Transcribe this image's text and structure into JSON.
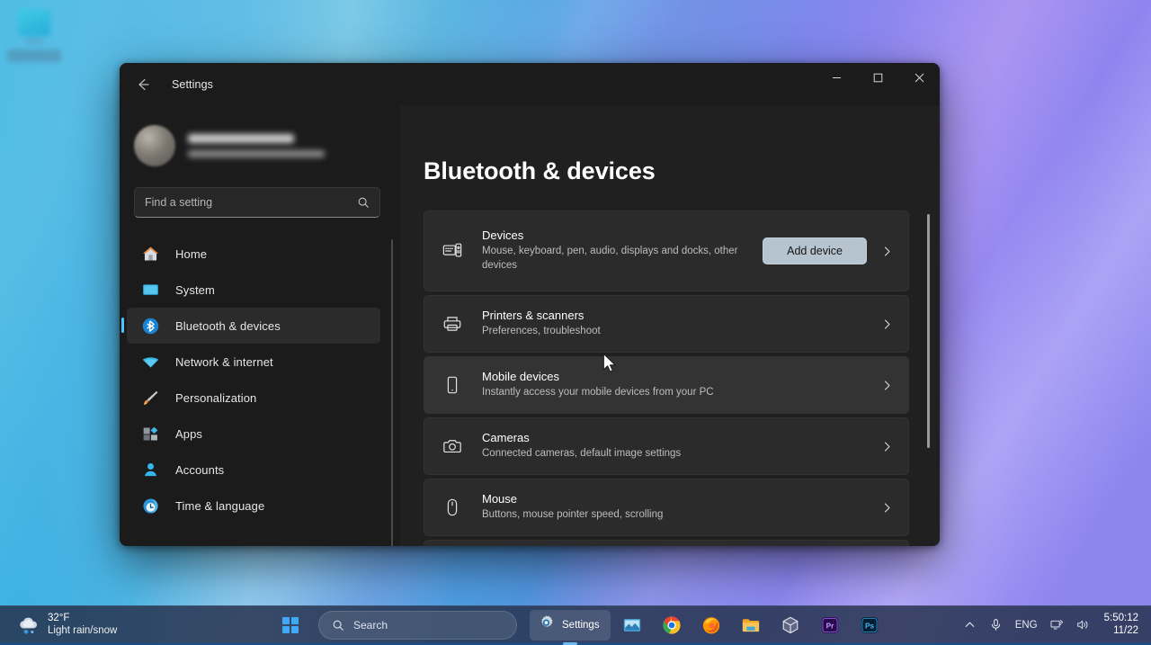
{
  "desktop": {
    "icon_name": "this-pc-desktop-icon",
    "wallpaper_colors": [
      "#14a8e0",
      "#7cc9e6",
      "#5f8fe0",
      "#8f87f0",
      "#8b86ee"
    ]
  },
  "window": {
    "title": "Settings",
    "back_icon": "back-arrow-icon",
    "minimize_label": "Minimize",
    "maximize_label": "Maximize",
    "close_label": "Close"
  },
  "sidebar": {
    "account": {
      "name": "",
      "email": "",
      "blurred": true
    },
    "search": {
      "placeholder": "Find a setting",
      "value": "",
      "icon": "search-icon"
    },
    "items": [
      {
        "label": "Home",
        "icon": "home-icon",
        "active": false
      },
      {
        "label": "System",
        "icon": "system-monitor-icon",
        "active": false
      },
      {
        "label": "Bluetooth & devices",
        "icon": "bluetooth-icon",
        "active": true
      },
      {
        "label": "Network & internet",
        "icon": "wifi-icon",
        "active": false
      },
      {
        "label": "Personalization",
        "icon": "paintbrush-icon",
        "active": false
      },
      {
        "label": "Apps",
        "icon": "apps-icon",
        "active": false
      },
      {
        "label": "Accounts",
        "icon": "account-person-icon",
        "active": false
      },
      {
        "label": "Time & language",
        "icon": "clock-globe-icon",
        "active": false
      }
    ]
  },
  "main": {
    "page_title": "Bluetooth & devices",
    "cards": [
      {
        "title": "Devices",
        "subtitle": "Mouse, keyboard, pen, audio, displays and docks, other devices",
        "icon": "devices-keyboard-icon",
        "action_label": "Add device",
        "hovered": false
      },
      {
        "title": "Printers & scanners",
        "subtitle": "Preferences, troubleshoot",
        "icon": "printer-icon",
        "action_label": "",
        "hovered": false
      },
      {
        "title": "Mobile devices",
        "subtitle": "Instantly access your mobile devices from your PC",
        "icon": "phone-icon",
        "action_label": "",
        "hovered": true
      },
      {
        "title": "Cameras",
        "subtitle": "Connected cameras, default image settings",
        "icon": "camera-icon",
        "action_label": "",
        "hovered": false
      },
      {
        "title": "Mouse",
        "subtitle": "Buttons, mouse pointer speed, scrolling",
        "icon": "mouse-icon",
        "action_label": "",
        "hovered": false
      }
    ],
    "chevron_icon": "chevron-right-icon",
    "accent_button_color": "#b6c4d0"
  },
  "taskbar": {
    "weather": {
      "temperature": "32°F",
      "condition": "Light rain/snow",
      "icon": "snow-cloud-icon"
    },
    "start_label": "Start",
    "search": {
      "placeholder": "Search",
      "icon": "search-icon"
    },
    "settings_task_label": "Settings",
    "apps": [
      {
        "name": "photos-app-icon"
      },
      {
        "name": "google-chrome-icon"
      },
      {
        "name": "mozilla-firefox-icon"
      },
      {
        "name": "file-explorer-icon"
      },
      {
        "name": "virtualbox-icon"
      },
      {
        "name": "premiere-pro-icon",
        "label": "Pr"
      },
      {
        "name": "photoshop-icon",
        "label": "Ps"
      }
    ],
    "tray": {
      "overflow_icon": "chevron-up-icon",
      "microphone_icon": "microphone-icon",
      "language": "ENG",
      "network_icon": "network-display-icon",
      "volume_icon": "speaker-icon",
      "time": "5:50:12",
      "date": "11/22"
    }
  }
}
